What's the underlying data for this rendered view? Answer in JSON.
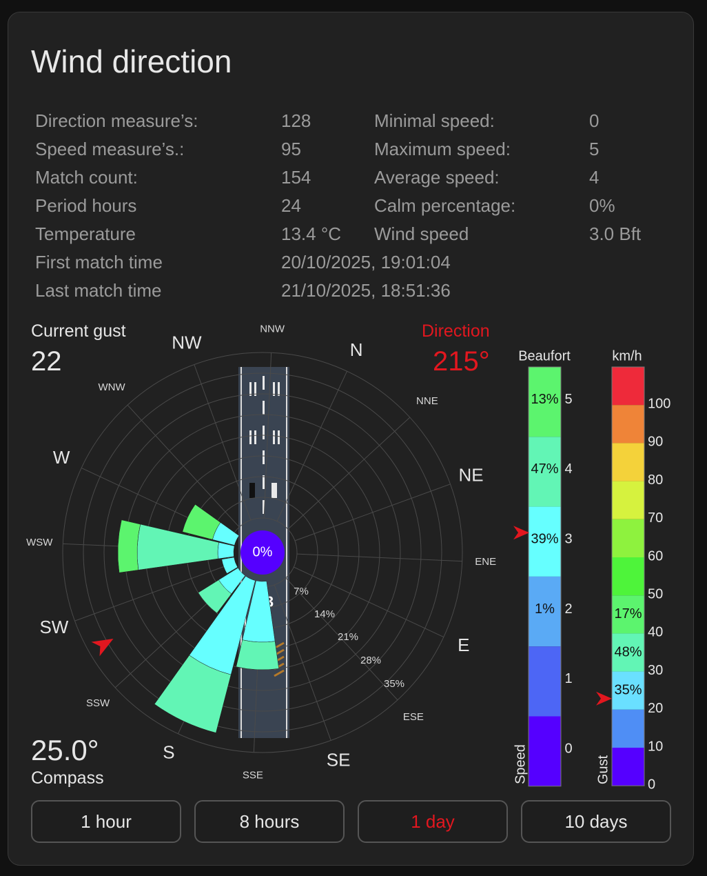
{
  "title": "Wind direction",
  "stats_left": [
    {
      "label": "Direction measure’s:",
      "value": "128"
    },
    {
      "label": "Speed measure’s.:",
      "value": "95"
    },
    {
      "label": "Match count:",
      "value": "154"
    },
    {
      "label": "Period hours",
      "value": "24"
    },
    {
      "label": "Temperature",
      "value": "13.4 °C"
    },
    {
      "label": "First match time",
      "value": "20/10/2025, 19:01:04"
    },
    {
      "label": "Last match time",
      "value": "21/10/2025, 18:51:36"
    }
  ],
  "stats_right": [
    {
      "label": "Minimal speed:",
      "value": "0"
    },
    {
      "label": "Maximum speed:",
      "value": "5"
    },
    {
      "label": "Average speed:",
      "value": "4"
    },
    {
      "label": "Calm percentage:",
      "value": "0%"
    },
    {
      "label": "Wind speed",
      "value": "3.0 Bft"
    }
  ],
  "gust": {
    "label": "Current gust",
    "value": "22"
  },
  "direction": {
    "label": "Direction",
    "value": "215°",
    "degrees": 215
  },
  "compass": {
    "label": "Compass",
    "value": "25.0°",
    "degrees": 25.0
  },
  "rose": {
    "center_label": "0%",
    "ring_labels": [
      "7%",
      "14%",
      "21%",
      "28%",
      "35%"
    ],
    "directions": [
      "N",
      "NNE",
      "NE",
      "ENE",
      "E",
      "ESE",
      "SE",
      "SSE",
      "S",
      "SSW",
      "SW",
      "WSW",
      "W",
      "WNW",
      "NW",
      "NNW"
    ],
    "runway_number": "3"
  },
  "beaufort_scale": {
    "title": "Beaufort",
    "axis_label": "Speed",
    "levels": [
      {
        "level": "5",
        "percent": "13%",
        "color": "#5cf46e"
      },
      {
        "level": "4",
        "percent": "47%",
        "color": "#62f5b5"
      },
      {
        "level": "3",
        "percent": "39%",
        "color": "#66ffff"
      },
      {
        "level": "2",
        "percent": "1%",
        "color": "#5aaaf5"
      },
      {
        "level": "1",
        "percent": "",
        "color": "#4d66f5"
      },
      {
        "level": "0",
        "percent": "",
        "color": "#5500ff"
      }
    ],
    "current_level": 3
  },
  "kmh_scale": {
    "title": "km/h",
    "axis_label": "Gust",
    "ticks": [
      "100",
      "90",
      "80",
      "70",
      "60",
      "50",
      "40",
      "30",
      "20",
      "10",
      "0"
    ],
    "bands": [
      {
        "color": "#ee2a3a",
        "percent": ""
      },
      {
        "color": "#ef8438",
        "percent": ""
      },
      {
        "color": "#f4d23a",
        "percent": ""
      },
      {
        "color": "#d6f23e",
        "percent": ""
      },
      {
        "color": "#8ef23e",
        "percent": ""
      },
      {
        "color": "#4ef43a",
        "percent": ""
      },
      {
        "color": "#5cf46e",
        "percent": "17%"
      },
      {
        "color": "#62f5b5",
        "percent": "48%"
      },
      {
        "color": "#6ae0ff",
        "percent": "35%"
      },
      {
        "color": "#4f8ef5",
        "percent": ""
      },
      {
        "color": "#5500ff",
        "percent": ""
      }
    ],
    "current_gust_kmh": 22
  },
  "buttons": [
    {
      "label": "1 hour",
      "active": false
    },
    {
      "label": "8 hours",
      "active": false
    },
    {
      "label": "1 day",
      "active": true
    },
    {
      "label": "10 days",
      "active": false
    }
  ],
  "colors": {
    "accent_red": "#e2171f",
    "card_bg": "#212121",
    "center_circle": "#5500ff"
  }
}
